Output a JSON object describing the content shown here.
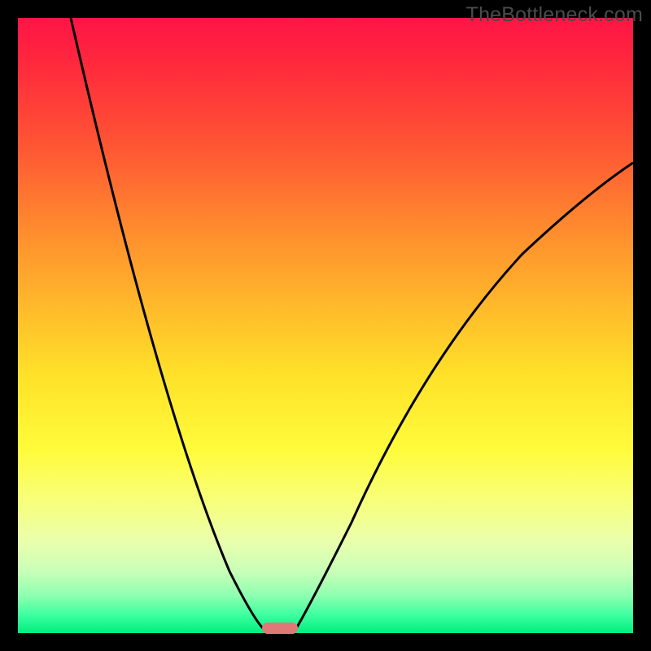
{
  "watermark": "TheBottleneck.com",
  "chart_data": {
    "type": "line",
    "title": "",
    "xlabel": "",
    "ylabel": "",
    "xlim": [
      0,
      100
    ],
    "ylim": [
      0,
      100
    ],
    "grid": false,
    "legend": false,
    "background_gradient": {
      "orientation": "vertical",
      "stops": [
        {
          "pos": 0,
          "color": "#ff1446"
        },
        {
          "pos": 22,
          "color": "#ff5a33"
        },
        {
          "pos": 46,
          "color": "#ffb62b"
        },
        {
          "pos": 70,
          "color": "#fffb3a"
        },
        {
          "pos": 90,
          "color": "#c8ffb8"
        },
        {
          "pos": 100,
          "color": "#00ef7e"
        }
      ]
    },
    "series": [
      {
        "name": "bottleneck-curve",
        "color": "#000000",
        "x": [
          8,
          12,
          16,
          20,
          24,
          28,
          32,
          36,
          40,
          42,
          45,
          50,
          55,
          60,
          65,
          70,
          75,
          80,
          85,
          90,
          95,
          100
        ],
        "values": [
          100,
          85,
          71,
          58,
          46,
          35,
          25,
          16,
          8,
          2,
          2,
          8,
          18,
          30,
          41,
          51,
          59,
          66,
          71,
          74,
          76,
          77
        ]
      }
    ],
    "annotations": [
      {
        "type": "marker",
        "name": "optimal-range",
        "shape": "rounded-rect",
        "color": "#e07878",
        "x_range": [
          40,
          46
        ],
        "y": 0
      }
    ],
    "notes": "V-shaped bottleneck curve over rainbow heat gradient; minimum (optimal) sits around x≈40–46 at y≈0. Left branch reaches y=100 near x≈8; right branch asymptotes toward y≈77 at x=100. No axis ticks or numeric labels are rendered in the source image; values are estimated from curve geometry."
  }
}
